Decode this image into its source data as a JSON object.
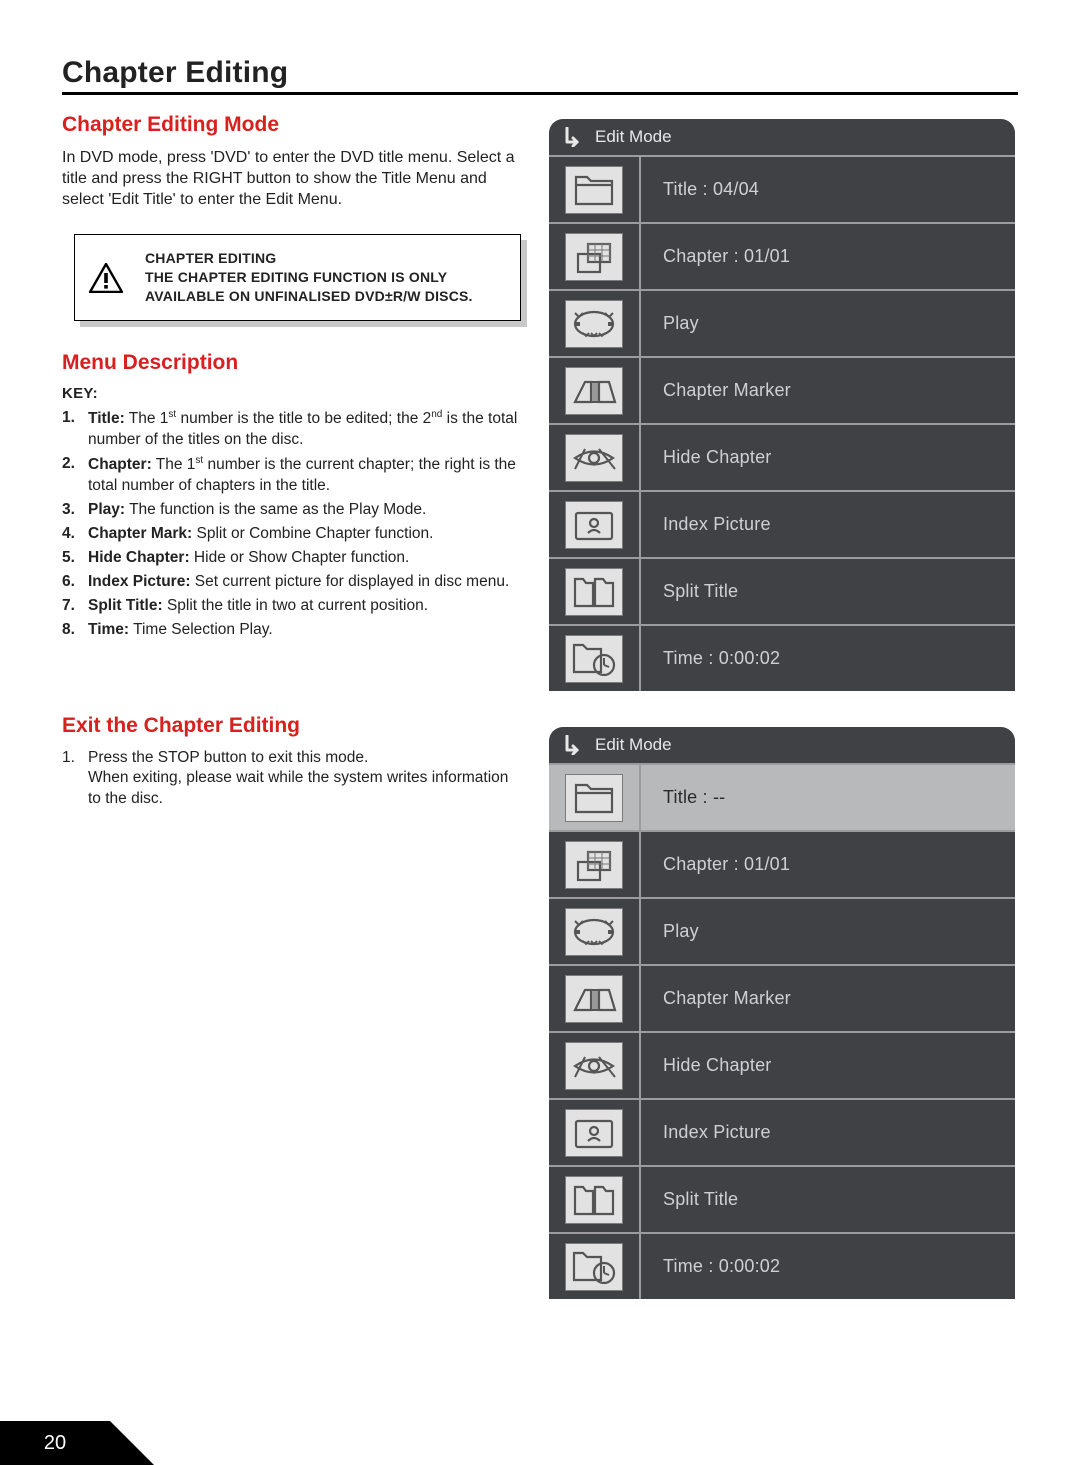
{
  "page_number": "20",
  "title": "Chapter Editing",
  "section1": {
    "heading": "Chapter Editing Mode",
    "body": "In DVD mode, press 'DVD' to enter the DVD title menu. Select a title and press the RIGHT button to show the Title Menu and select 'Edit Title' to enter the Edit Menu."
  },
  "note": {
    "line1": "CHAPTER EDITING",
    "line2": "THE CHAPTER EDITING FUNCTION IS ONLY AVAILABLE ON UNFINALISED DVD±R/W DISCS."
  },
  "section2": {
    "heading": "Menu Description",
    "key_label": "KEY:",
    "items": [
      {
        "label": "Title:",
        "pre": "The 1",
        "sup1": "st",
        "mid": " number is the title to be edited; the 2",
        "sup2": "nd",
        "post": " is the total number of the titles on the disc."
      },
      {
        "label": "Chapter:",
        "pre": "The 1",
        "sup1": "st",
        "mid": " number is the current chapter; the right is the total number of chapters in the title.",
        "sup2": "",
        "post": ""
      },
      {
        "label": "Play:",
        "pre": "The function is the same as the Play Mode.",
        "sup1": "",
        "mid": "",
        "sup2": "",
        "post": ""
      },
      {
        "label": "Chapter Mark:",
        "pre": "Split or Combine Chapter function.",
        "sup1": "",
        "mid": "",
        "sup2": "",
        "post": ""
      },
      {
        "label": "Hide Chapter:",
        "pre": "Hide or Show Chapter function.",
        "sup1": "",
        "mid": "",
        "sup2": "",
        "post": ""
      },
      {
        "label": "Index Picture:",
        "pre": "Set current picture for displayed in disc menu.",
        "sup1": "",
        "mid": "",
        "sup2": "",
        "post": ""
      },
      {
        "label": "Split Title:",
        "pre": "Split the title in two at current position.",
        "sup1": "",
        "mid": "",
        "sup2": "",
        "post": ""
      },
      {
        "label": "Time:",
        "pre": "Time Selection Play.",
        "sup1": "",
        "mid": "",
        "sup2": "",
        "post": ""
      }
    ]
  },
  "section3": {
    "heading": "Exit the Chapter Editing",
    "item1a": "Press the STOP button to exit this mode.",
    "item1b": "When exiting, please wait while the system writes information to the disc."
  },
  "osd_header": "Edit Mode",
  "osd1_rows": [
    {
      "icon": "folder",
      "label": "Title : 04/04",
      "selected": false
    },
    {
      "icon": "grid",
      "label": "Chapter : 01/01",
      "selected": false
    },
    {
      "icon": "repeat",
      "label": "Play",
      "selected": false
    },
    {
      "icon": "marker",
      "label": "Chapter Marker",
      "selected": false
    },
    {
      "icon": "hide",
      "label": "Hide Chapter",
      "selected": false
    },
    {
      "icon": "index",
      "label": "Index Picture",
      "selected": false
    },
    {
      "icon": "split",
      "label": "Split Title",
      "selected": false
    },
    {
      "icon": "clock",
      "label": "Time : 0:00:02",
      "selected": false
    }
  ],
  "osd2_rows": [
    {
      "icon": "folder",
      "label": "Title : --",
      "selected": true
    },
    {
      "icon": "grid",
      "label": "Chapter : 01/01",
      "selected": false
    },
    {
      "icon": "repeat",
      "label": "Play",
      "selected": false
    },
    {
      "icon": "marker",
      "label": "Chapter Marker",
      "selected": false
    },
    {
      "icon": "hide",
      "label": "Hide Chapter",
      "selected": false
    },
    {
      "icon": "index",
      "label": "Index Picture",
      "selected": false
    },
    {
      "icon": "split",
      "label": "Split Title",
      "selected": false
    },
    {
      "icon": "clock",
      "label": "Time : 0:00:02",
      "selected": false
    }
  ]
}
